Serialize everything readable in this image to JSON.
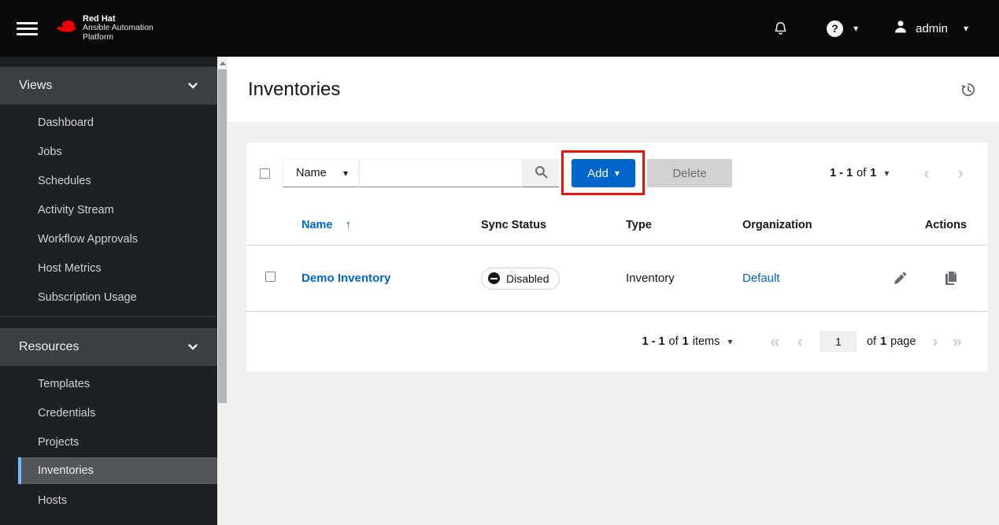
{
  "masthead": {
    "brand": {
      "name": "Red Hat",
      "line2": "Ansible Automation",
      "line3": "Platform"
    },
    "user_menu": {
      "username": "admin"
    }
  },
  "sidebar": {
    "sections": [
      {
        "label": "Views",
        "items": [
          {
            "label": "Dashboard"
          },
          {
            "label": "Jobs"
          },
          {
            "label": "Schedules"
          },
          {
            "label": "Activity Stream"
          },
          {
            "label": "Workflow Approvals"
          },
          {
            "label": "Host Metrics"
          },
          {
            "label": "Subscription Usage"
          }
        ]
      },
      {
        "label": "Resources",
        "items": [
          {
            "label": "Templates"
          },
          {
            "label": "Credentials"
          },
          {
            "label": "Projects"
          },
          {
            "label": "Inventories",
            "active": true
          },
          {
            "label": "Hosts"
          }
        ]
      }
    ]
  },
  "page": {
    "title": "Inventories"
  },
  "toolbar": {
    "filter_selected": "Name",
    "search_value": "",
    "add_label": "Add",
    "delete_label": "Delete",
    "pagination": {
      "range": "1 - 1",
      "of_label": "of",
      "total": "1"
    }
  },
  "table": {
    "columns": [
      "Name",
      "Sync Status",
      "Type",
      "Organization",
      "Actions"
    ],
    "rows": [
      {
        "name": "Demo Inventory",
        "sync_status": "Disabled",
        "type": "Inventory",
        "organization": "Default"
      }
    ]
  },
  "footer_pagination": {
    "range": "1 - 1",
    "of_label": "of",
    "total": "1",
    "items_label": "items",
    "page_value": "1",
    "page_of_label": "of",
    "page_total": "1",
    "page_label": "page"
  },
  "icons": {
    "help_glyph": "?",
    "caret_down": "▾",
    "sort_ascending": "↑",
    "nav_first": "«",
    "nav_prev": "‹",
    "nav_next": "›",
    "nav_last": "»"
  },
  "colors": {
    "primary_blue": "#0066cc",
    "link_blue": "#0066cc",
    "annotation_red": "#e8120e",
    "nav_active_accent": "#73bcf7",
    "disabled_gray": "#d2d2d2"
  }
}
